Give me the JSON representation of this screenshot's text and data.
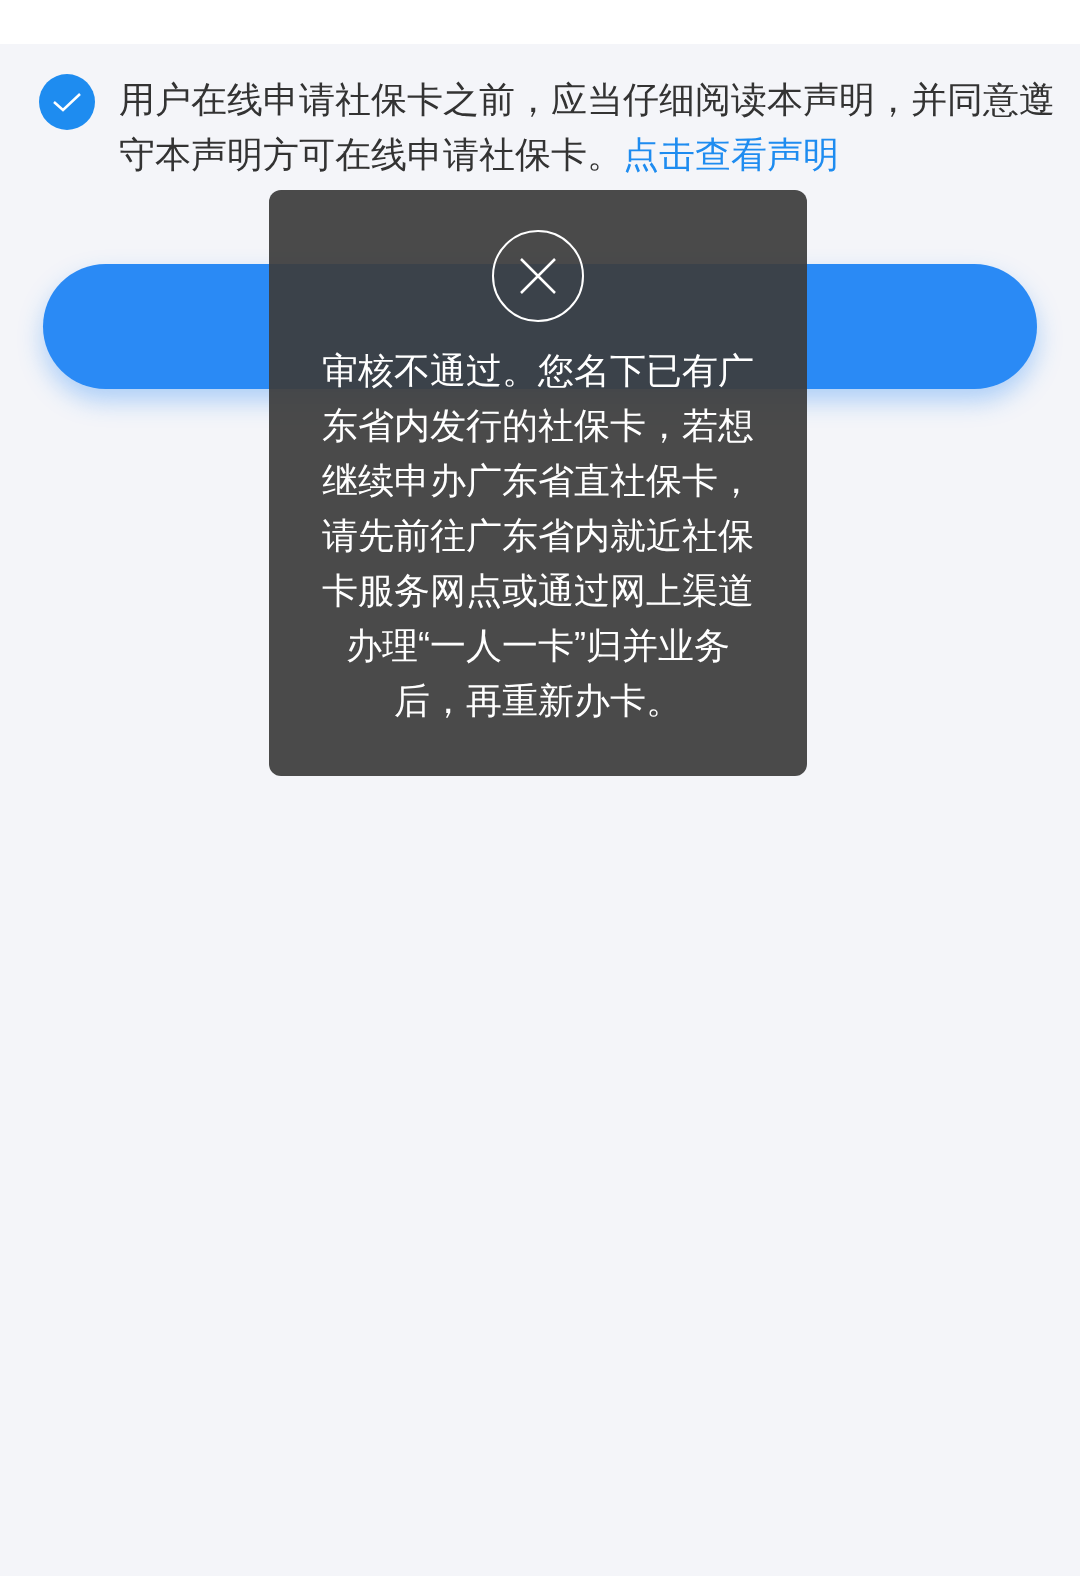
{
  "agreement": {
    "checked": true,
    "text": "用户在线申请社保卡之前，应当仔细阅读本声明，并同意遵守本声明方可在线申请社保卡。",
    "link": "点击查看声明"
  },
  "toast": {
    "message": "审核不通过。您名下已有广东省内发行的社保卡，若想继续申办广东省直社保卡，请先前往广东省内就近社保卡服务网点或通过网上渠道办理“一人一卡”归并业务后，再重新办卡。"
  }
}
